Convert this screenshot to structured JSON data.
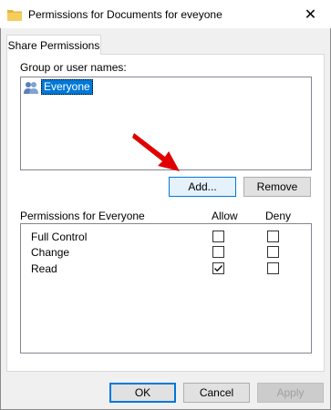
{
  "window": {
    "title": "Permissions for Documents for eveyone",
    "close_glyph": "✕"
  },
  "tabs": [
    {
      "label": "Share Permissions"
    }
  ],
  "groups": {
    "label": "Group or user names:",
    "items": [
      {
        "name": "Everyone",
        "icon": "users-icon",
        "selected": true
      }
    ]
  },
  "buttons": {
    "add": "Add...",
    "remove": "Remove",
    "ok": "OK",
    "cancel": "Cancel",
    "apply": "Apply"
  },
  "permissions": {
    "label": "Permissions for Everyone",
    "allow_header": "Allow",
    "deny_header": "Deny",
    "rows": [
      {
        "name": "Full Control",
        "allow": false,
        "deny": false
      },
      {
        "name": "Change",
        "allow": false,
        "deny": false
      },
      {
        "name": "Read",
        "allow": true,
        "deny": false
      }
    ]
  },
  "colors": {
    "selection": "#0078d7",
    "annotation_arrow": "#e00000"
  }
}
